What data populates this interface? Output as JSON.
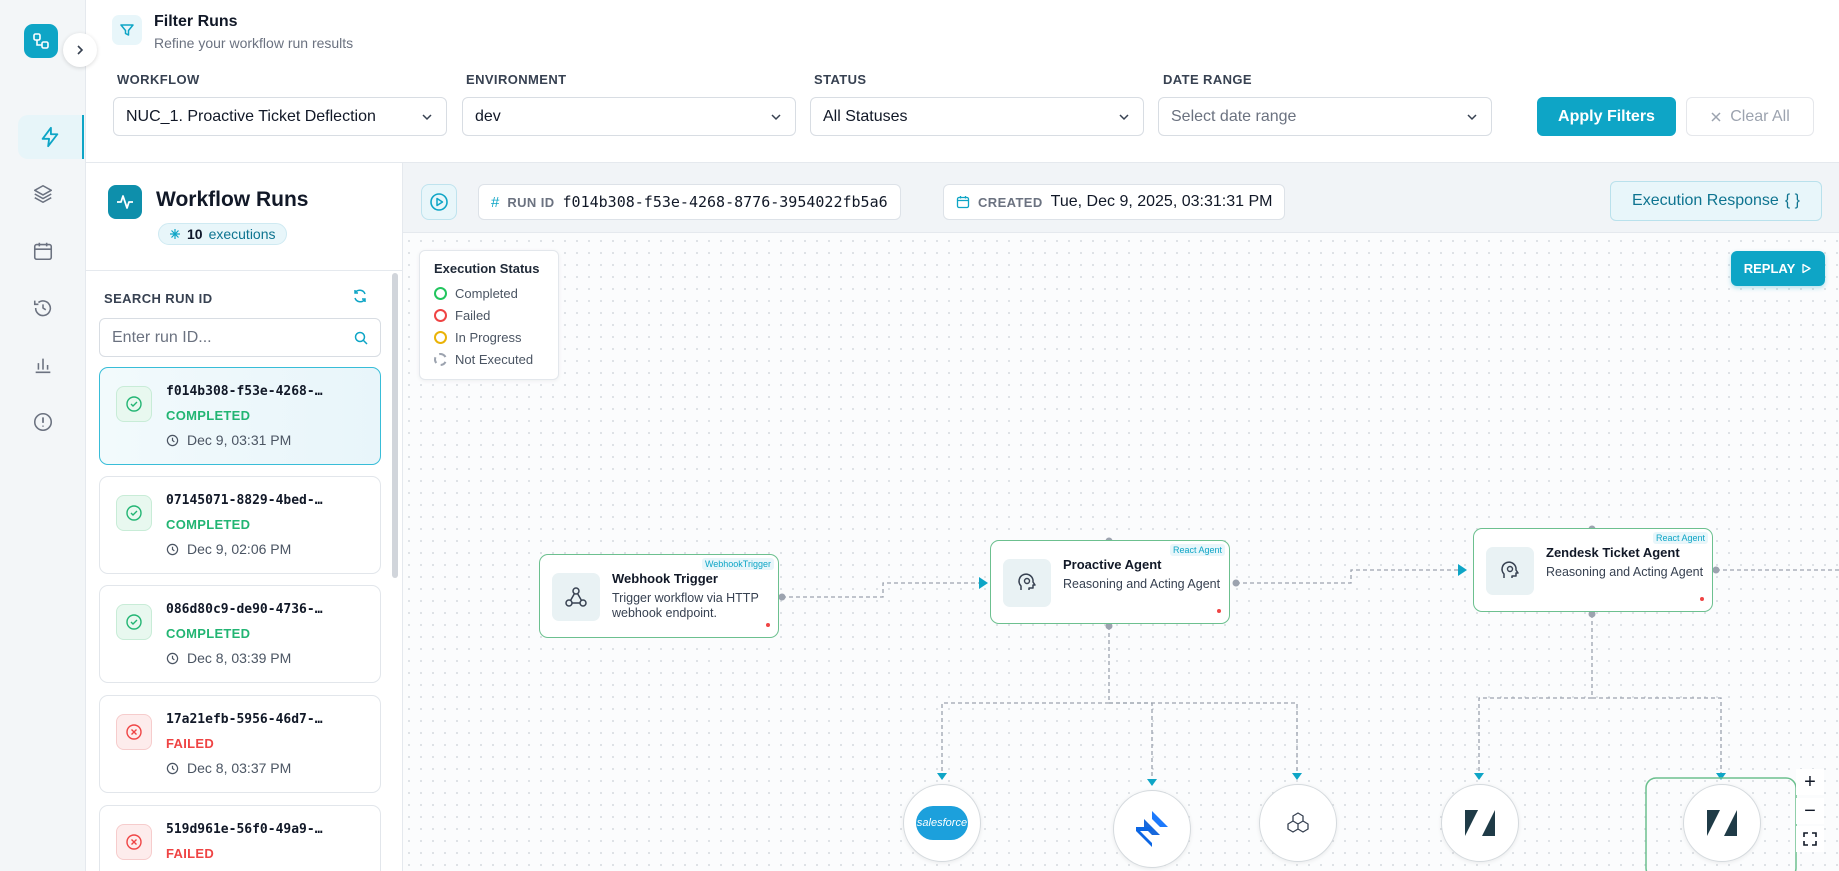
{
  "filters": {
    "title": "Filter Runs",
    "subtitle": "Refine your workflow run results",
    "workflow_label": "WORKFLOW",
    "workflow_value": "NUC_1. Proactive Ticket Deflection",
    "environment_label": "ENVIRONMENT",
    "environment_value": "dev",
    "status_label": "STATUS",
    "status_value": "All Statuses",
    "date_label": "DATE RANGE",
    "date_placeholder": "Select date range",
    "apply": "Apply Filters",
    "clear": "Clear All"
  },
  "runs": {
    "title": "Workflow Runs",
    "count": "10",
    "count_suffix": "executions",
    "search_label": "SEARCH RUN ID",
    "search_placeholder": "Enter run ID...",
    "items": [
      {
        "id": "f014b308-f53e-4268-…",
        "status": "COMPLETED",
        "date": "Dec 9, 03:31 PM"
      },
      {
        "id": "07145071-8829-4bed-…",
        "status": "COMPLETED",
        "date": "Dec 9, 02:06 PM"
      },
      {
        "id": "086d80c9-de90-4736-…",
        "status": "COMPLETED",
        "date": "Dec 8, 03:39 PM"
      },
      {
        "id": "17a21efb-5956-46d7-…",
        "status": "FAILED",
        "date": "Dec 8, 03:37 PM"
      },
      {
        "id": "519d961e-56f0-49a9-…",
        "status": "FAILED",
        "date": ""
      }
    ]
  },
  "toolbar": {
    "run_id_label": "RUN ID",
    "run_id": "f014b308-f53e-4268-8776-3954022fb5a6",
    "created_label": "CREATED",
    "created": "Tue, Dec 9, 2025, 03:31:31 PM",
    "execution_response": "Execution Response",
    "execution_response_glyph": "{ }"
  },
  "legend": {
    "title": "Execution Status",
    "items": [
      {
        "label": "Completed",
        "color": "#22c55e"
      },
      {
        "label": "Failed",
        "color": "#ef4444"
      },
      {
        "label": "In Progress",
        "color": "#eab308"
      },
      {
        "label": "Not Executed",
        "color": "#9ca3af"
      }
    ]
  },
  "replay": "REPLAY",
  "nodes": {
    "webhook": {
      "title": "Webhook Trigger",
      "desc": "Trigger workflow via HTTP webhook endpoint.",
      "tag": "WebhookTrigger"
    },
    "proactive": {
      "title": "Proactive Agent",
      "desc": "Reasoning and Acting Agent",
      "tag": "React Agent"
    },
    "zendesk": {
      "title": "Zendesk Ticket Agent",
      "desc": "Reasoning and Acting Agent",
      "tag": "React Agent"
    }
  },
  "tools": {
    "salesforce": "salesforce"
  },
  "zoom": {
    "in": "+",
    "out": "−"
  },
  "colors": {
    "accent": "#0ea5c6",
    "completed": "#22b573",
    "failed": "#ef4444"
  }
}
